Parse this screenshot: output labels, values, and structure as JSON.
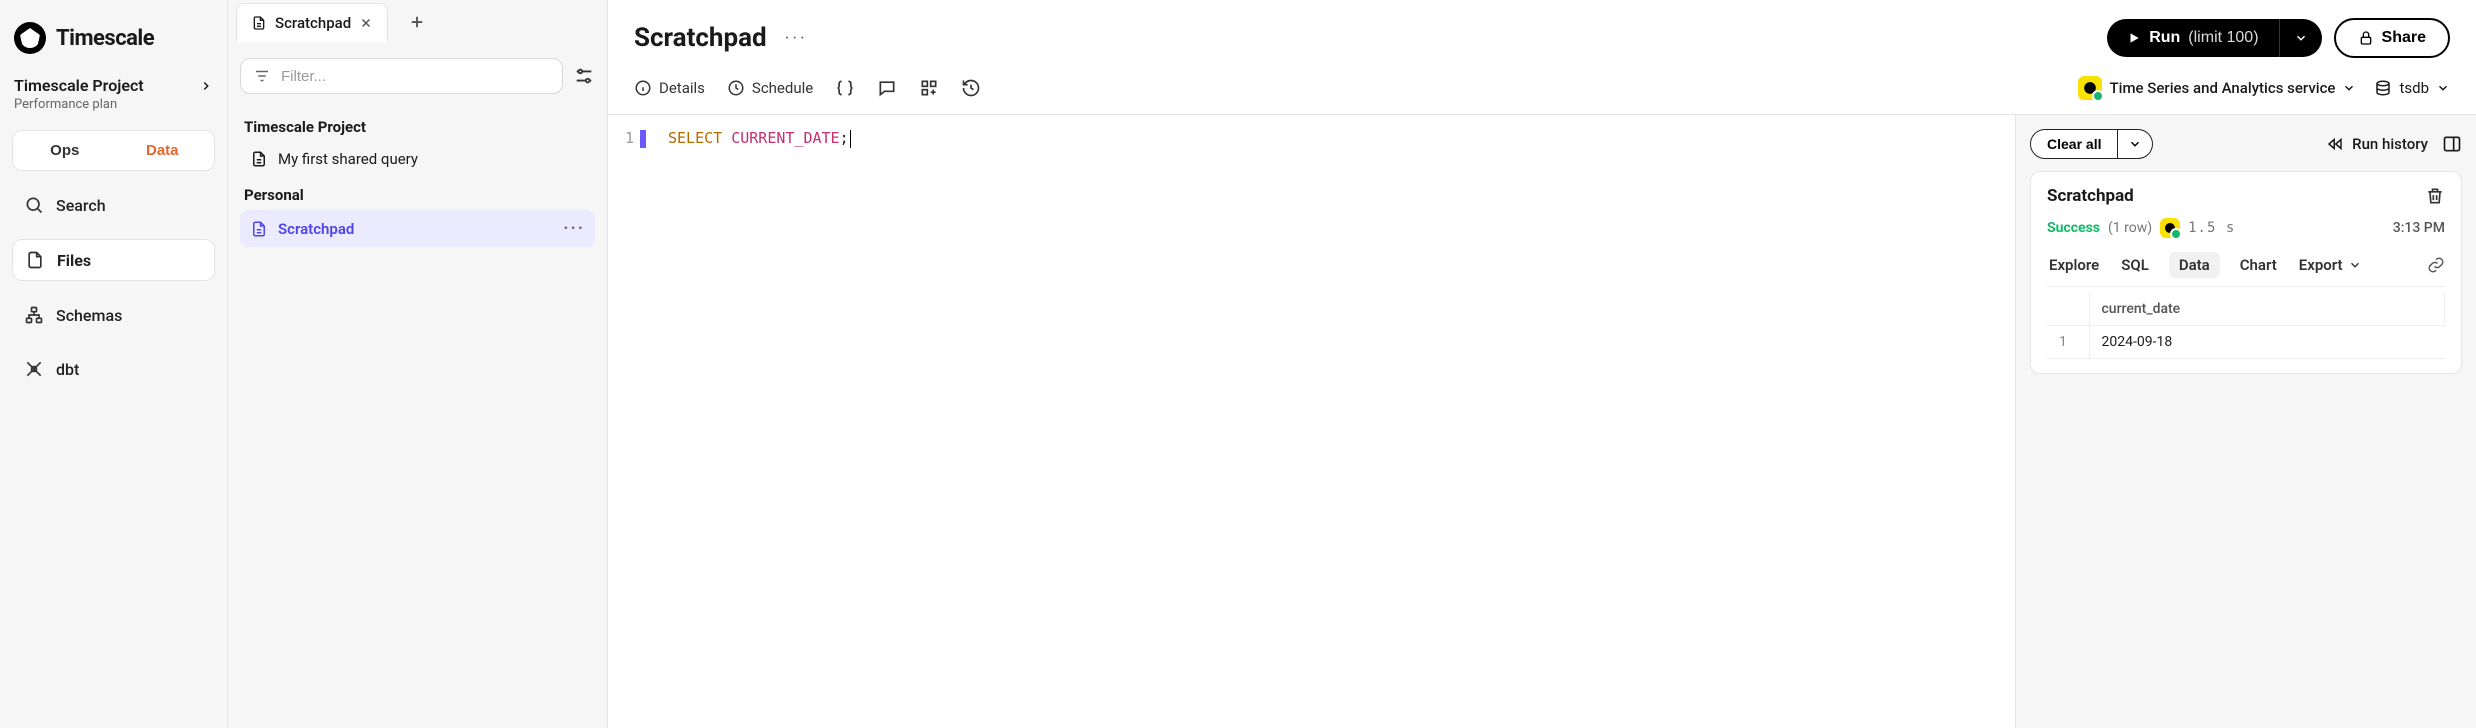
{
  "brand": {
    "name": "Timescale"
  },
  "project": {
    "name": "Timescale Project",
    "plan": "Performance plan"
  },
  "left_tabs": {
    "ops": "Ops",
    "data": "Data"
  },
  "nav": {
    "search": "Search",
    "files": "Files",
    "schemas": "Schemas",
    "dbt": "dbt"
  },
  "file_tabs": [
    {
      "label": "Scratchpad"
    }
  ],
  "filter": {
    "placeholder": "Filter..."
  },
  "tree": {
    "project_heading": "Timescale Project",
    "project_items": [
      {
        "label": "My first shared query"
      }
    ],
    "personal_heading": "Personal",
    "personal_items": [
      {
        "label": "Scratchpad"
      }
    ]
  },
  "page": {
    "title": "Scratchpad",
    "run_label": "Run",
    "run_limit": "(limit 100)",
    "share_label": "Share"
  },
  "toolbar": {
    "details": "Details",
    "schedule": "Schedule",
    "service": "Time Series and Analytics service",
    "db": "tsdb"
  },
  "editor": {
    "line_no": "1",
    "tok_select": "SELECT",
    "tok_ident": "CURRENT_DATE",
    "tok_semi": ";"
  },
  "results": {
    "clear_all": "Clear all",
    "run_history": "Run history",
    "card": {
      "title": "Scratchpad",
      "status": "Success",
      "rowcount": "(1 row)",
      "duration": "1.5 s",
      "time": "3:13 PM",
      "tabs": {
        "explore": "Explore",
        "sql": "SQL",
        "data": "Data",
        "chart": "Chart",
        "export": "Export"
      },
      "table": {
        "columns": [
          "current_date"
        ],
        "rows": [
          {
            "idx": "1",
            "cells": [
              "2024-09-18"
            ]
          }
        ]
      }
    }
  }
}
